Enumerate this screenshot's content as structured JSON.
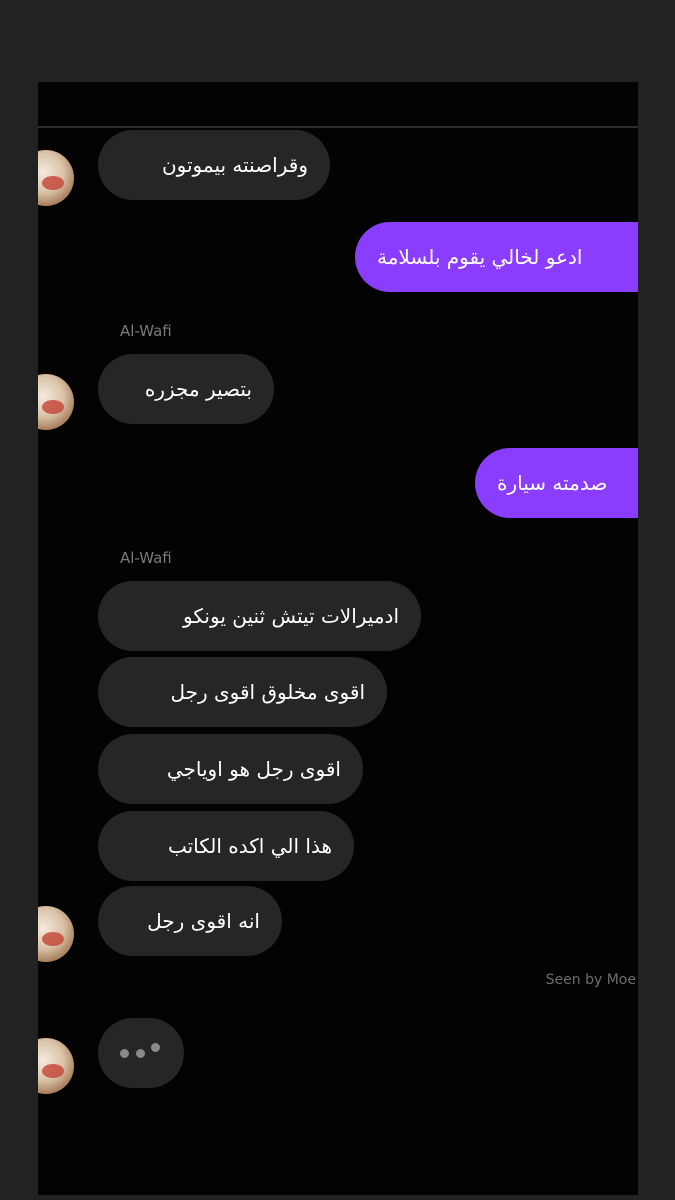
{
  "conversation": {
    "messages": [
      {
        "text": "وقراصنته بيموتون"
      },
      {
        "text": "ادعو لخالي يقوم بلسلامة"
      },
      {
        "sender": "Al-Wafi",
        "text": "بتصير مجزره"
      },
      {
        "text": "صدمته سيارة"
      },
      {
        "sender": "Al-Wafi",
        "text": "ادميرالات تيتش ثنين يونكو"
      },
      {
        "text": "اقوى مخلوق اقوى رجل"
      },
      {
        "text": "اقوى رجل هو اوياجي"
      },
      {
        "text": "هذا الي اكده الكاتب"
      },
      {
        "text": "انه اقوى رجل"
      }
    ],
    "seen_status": "Seen by Moe"
  },
  "colors": {
    "outgoing_bubble": "#8b3dff",
    "incoming_bubble": "#262628",
    "background": "#030303"
  },
  "icons": {
    "typing_indicator": "three-dots"
  }
}
